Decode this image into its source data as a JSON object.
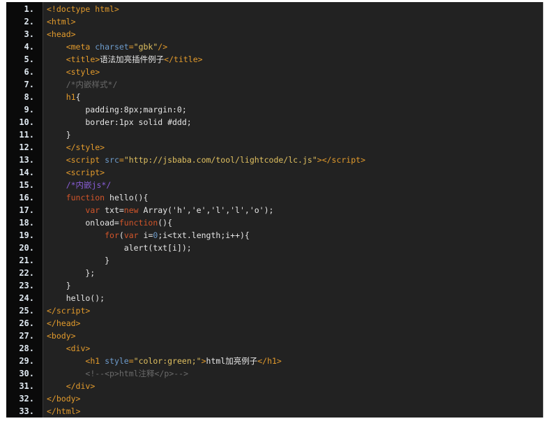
{
  "code_lines": [
    [
      [
        "t",
        "<!doctype html>"
      ]
    ],
    [
      [
        "t",
        "<html>"
      ]
    ],
    [
      [
        "t",
        "<head>"
      ]
    ],
    [
      [
        "p",
        "    "
      ],
      [
        "t",
        "<meta "
      ],
      [
        "a",
        "charset"
      ],
      [
        "t",
        "="
      ],
      [
        "s",
        "\"gbk\""
      ],
      [
        "t",
        "/>"
      ]
    ],
    [
      [
        "p",
        "    "
      ],
      [
        "t",
        "<title>"
      ],
      [
        "p",
        "语法加亮插件例子"
      ],
      [
        "t",
        "</title>"
      ]
    ],
    [
      [
        "p",
        "    "
      ],
      [
        "t",
        "<style>"
      ]
    ],
    [
      [
        "p",
        "    "
      ],
      [
        "c",
        "/*内嵌样式*/"
      ]
    ],
    [
      [
        "p",
        "    "
      ],
      [
        "t",
        "h1"
      ],
      [
        "p",
        "{"
      ]
    ],
    [
      [
        "p",
        "        padding:8px;margin:0;"
      ]
    ],
    [
      [
        "p",
        "        border:1px solid #ddd;"
      ]
    ],
    [
      [
        "p",
        "    }"
      ]
    ],
    [
      [
        "p",
        "    "
      ],
      [
        "t",
        "</style>"
      ]
    ],
    [
      [
        "p",
        "    "
      ],
      [
        "t",
        "<script "
      ],
      [
        "a",
        "src"
      ],
      [
        "t",
        "="
      ],
      [
        "s",
        "\"http://jsbaba.com/tool/lightcode/lc.js\""
      ],
      [
        "t",
        "></script>"
      ]
    ],
    [
      [
        "p",
        "    "
      ],
      [
        "t",
        "<script>"
      ]
    ],
    [
      [
        "p",
        "    "
      ],
      [
        "j",
        "/*内嵌js*/"
      ]
    ],
    [
      [
        "p",
        "    "
      ],
      [
        "k",
        "function"
      ],
      [
        "p",
        " hello(){"
      ]
    ],
    [
      [
        "p",
        "        "
      ],
      [
        "k",
        "var"
      ],
      [
        "p",
        " txt="
      ],
      [
        "k",
        "new"
      ],
      [
        "p",
        " Array('h','e','l','l','o');"
      ]
    ],
    [
      [
        "p",
        "        onload="
      ],
      [
        "k",
        "function"
      ],
      [
        "p",
        "(){"
      ]
    ],
    [
      [
        "p",
        "            "
      ],
      [
        "k",
        "for"
      ],
      [
        "p",
        "("
      ],
      [
        "k",
        "var"
      ],
      [
        "p",
        " i="
      ],
      [
        "n",
        "0"
      ],
      [
        "p",
        ";i<txt.length;i++){"
      ]
    ],
    [
      [
        "p",
        "                alert(txt[i]);"
      ]
    ],
    [
      [
        "p",
        "            }"
      ]
    ],
    [
      [
        "p",
        "        };"
      ]
    ],
    [
      [
        "p",
        "    }"
      ]
    ],
    [
      [
        "p",
        "    hello();"
      ]
    ],
    [
      [
        "t",
        "</script>"
      ]
    ],
    [
      [
        "t",
        "</head>"
      ]
    ],
    [
      [
        "t",
        "<body>"
      ]
    ],
    [
      [
        "p",
        "    "
      ],
      [
        "t",
        "<div>"
      ]
    ],
    [
      [
        "p",
        "        "
      ],
      [
        "t",
        "<h1 "
      ],
      [
        "a",
        "style"
      ],
      [
        "t",
        "="
      ],
      [
        "s",
        "\"color:green;\""
      ],
      [
        "t",
        ">"
      ],
      [
        "p",
        "html加亮例子"
      ],
      [
        "t",
        "</h1>"
      ]
    ],
    [
      [
        "p",
        "        "
      ],
      [
        "c",
        "<!--<p>html注释</p>-->"
      ]
    ],
    [
      [
        "p",
        "    "
      ],
      [
        "t",
        "</div>"
      ]
    ],
    [
      [
        "t",
        "</body>"
      ]
    ],
    [
      [
        "t",
        "</html>"
      ]
    ]
  ]
}
